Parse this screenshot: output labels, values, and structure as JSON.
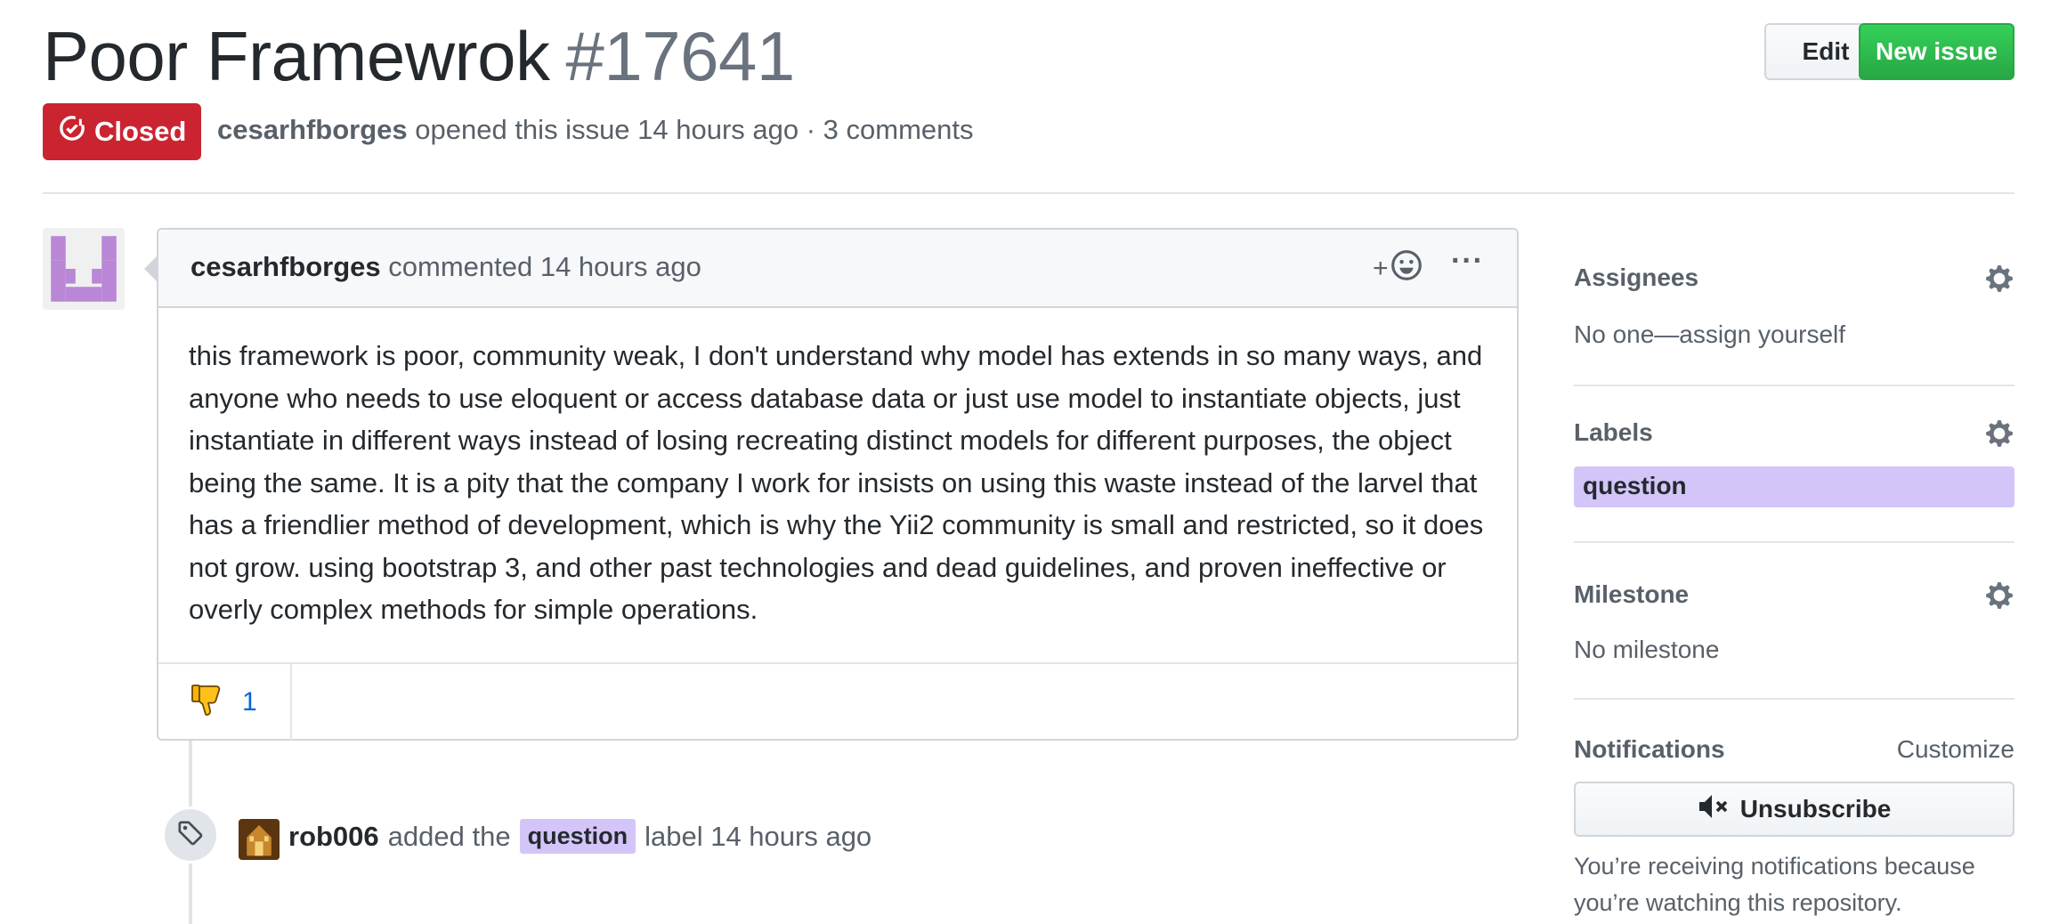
{
  "issue": {
    "title": "Poor Framewrok",
    "number": "#17641",
    "state": "Closed",
    "author": "cesarhfborges",
    "opened_text": "opened this issue 14 hours ago · 3 comments"
  },
  "header_actions": {
    "edit_label": "Edit",
    "new_issue_label": "New issue"
  },
  "comment": {
    "author": "cesarhfborges",
    "time_text": "commented 14 hours ago",
    "add_reaction": "+",
    "more": "···",
    "body": "this framework is poor, community weak, I don't understand why model has extends in so many ways, and anyone who needs to use eloquent or access database data or just use model to instantiate objects, just instantiate in different ways instead of losing recreating distinct models for different purposes, the object being the same. It is a pity that the company I work for insists on using this waste instead of the larvel that has a friendlier method of development, which is why the Yii2 community is small and restricted, so it does not grow. using bootstrap 3, and other past technologies and dead guidelines, and proven ineffective or overly complex methods for simple operations.",
    "reactions": [
      {
        "icon": "thumbs-down-icon",
        "count": "1"
      }
    ]
  },
  "timeline_event": {
    "actor": "rob006",
    "text_before": "added the",
    "label": "question",
    "text_after": "label 14 hours ago"
  },
  "sidebar": {
    "assignees": {
      "heading": "Assignees",
      "value": "No one—assign yourself"
    },
    "labels": {
      "heading": "Labels",
      "items": [
        "question"
      ]
    },
    "milestone": {
      "heading": "Milestone",
      "value": "No milestone"
    },
    "notifications": {
      "heading": "Notifications",
      "customize": "Customize",
      "button": "Unsubscribe",
      "notice": "You’re receiving notifications because you’re watching this repository."
    }
  },
  "colors": {
    "closed": "#cb2431",
    "new_issue": "#28a745",
    "label_question": "#d4c5f9",
    "link": "#0366d6"
  }
}
